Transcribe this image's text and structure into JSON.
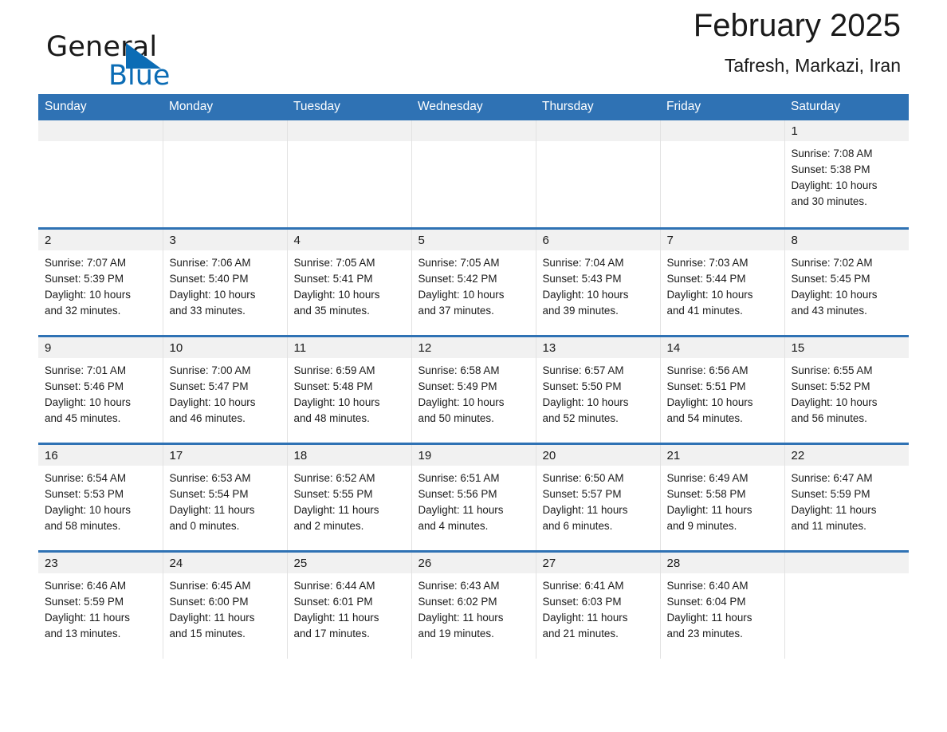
{
  "brand": {
    "name_part1": "General",
    "name_part2": "Blue",
    "flag_icon": "blue-triangle-flag-icon",
    "accent_color": "#0b6cb5"
  },
  "header": {
    "title": "February 2025",
    "subtitle": "Tafresh, Markazi, Iran"
  },
  "colors": {
    "header_row_bg": "#2f72b4",
    "daynum_band_bg": "#f1f1f1",
    "cell_border": "#2f72b4",
    "text": "#1a1a1a"
  },
  "calendar": {
    "weekday_headers": [
      "Sunday",
      "Monday",
      "Tuesday",
      "Wednesday",
      "Thursday",
      "Friday",
      "Saturday"
    ],
    "weeks": [
      [
        {
          "day": "",
          "empty": true
        },
        {
          "day": "",
          "empty": true
        },
        {
          "day": "",
          "empty": true
        },
        {
          "day": "",
          "empty": true
        },
        {
          "day": "",
          "empty": true
        },
        {
          "day": "",
          "empty": true
        },
        {
          "day": "1",
          "sunrise": "Sunrise: 7:08 AM",
          "sunset": "Sunset: 5:38 PM",
          "daylight_line1": "Daylight: 10 hours",
          "daylight_line2": "and 30 minutes."
        }
      ],
      [
        {
          "day": "2",
          "sunrise": "Sunrise: 7:07 AM",
          "sunset": "Sunset: 5:39 PM",
          "daylight_line1": "Daylight: 10 hours",
          "daylight_line2": "and 32 minutes."
        },
        {
          "day": "3",
          "sunrise": "Sunrise: 7:06 AM",
          "sunset": "Sunset: 5:40 PM",
          "daylight_line1": "Daylight: 10 hours",
          "daylight_line2": "and 33 minutes."
        },
        {
          "day": "4",
          "sunrise": "Sunrise: 7:05 AM",
          "sunset": "Sunset: 5:41 PM",
          "daylight_line1": "Daylight: 10 hours",
          "daylight_line2": "and 35 minutes."
        },
        {
          "day": "5",
          "sunrise": "Sunrise: 7:05 AM",
          "sunset": "Sunset: 5:42 PM",
          "daylight_line1": "Daylight: 10 hours",
          "daylight_line2": "and 37 minutes."
        },
        {
          "day": "6",
          "sunrise": "Sunrise: 7:04 AM",
          "sunset": "Sunset: 5:43 PM",
          "daylight_line1": "Daylight: 10 hours",
          "daylight_line2": "and 39 minutes."
        },
        {
          "day": "7",
          "sunrise": "Sunrise: 7:03 AM",
          "sunset": "Sunset: 5:44 PM",
          "daylight_line1": "Daylight: 10 hours",
          "daylight_line2": "and 41 minutes."
        },
        {
          "day": "8",
          "sunrise": "Sunrise: 7:02 AM",
          "sunset": "Sunset: 5:45 PM",
          "daylight_line1": "Daylight: 10 hours",
          "daylight_line2": "and 43 minutes."
        }
      ],
      [
        {
          "day": "9",
          "sunrise": "Sunrise: 7:01 AM",
          "sunset": "Sunset: 5:46 PM",
          "daylight_line1": "Daylight: 10 hours",
          "daylight_line2": "and 45 minutes."
        },
        {
          "day": "10",
          "sunrise": "Sunrise: 7:00 AM",
          "sunset": "Sunset: 5:47 PM",
          "daylight_line1": "Daylight: 10 hours",
          "daylight_line2": "and 46 minutes."
        },
        {
          "day": "11",
          "sunrise": "Sunrise: 6:59 AM",
          "sunset": "Sunset: 5:48 PM",
          "daylight_line1": "Daylight: 10 hours",
          "daylight_line2": "and 48 minutes."
        },
        {
          "day": "12",
          "sunrise": "Sunrise: 6:58 AM",
          "sunset": "Sunset: 5:49 PM",
          "daylight_line1": "Daylight: 10 hours",
          "daylight_line2": "and 50 minutes."
        },
        {
          "day": "13",
          "sunrise": "Sunrise: 6:57 AM",
          "sunset": "Sunset: 5:50 PM",
          "daylight_line1": "Daylight: 10 hours",
          "daylight_line2": "and 52 minutes."
        },
        {
          "day": "14",
          "sunrise": "Sunrise: 6:56 AM",
          "sunset": "Sunset: 5:51 PM",
          "daylight_line1": "Daylight: 10 hours",
          "daylight_line2": "and 54 minutes."
        },
        {
          "day": "15",
          "sunrise": "Sunrise: 6:55 AM",
          "sunset": "Sunset: 5:52 PM",
          "daylight_line1": "Daylight: 10 hours",
          "daylight_line2": "and 56 minutes."
        }
      ],
      [
        {
          "day": "16",
          "sunrise": "Sunrise: 6:54 AM",
          "sunset": "Sunset: 5:53 PM",
          "daylight_line1": "Daylight: 10 hours",
          "daylight_line2": "and 58 minutes."
        },
        {
          "day": "17",
          "sunrise": "Sunrise: 6:53 AM",
          "sunset": "Sunset: 5:54 PM",
          "daylight_line1": "Daylight: 11 hours",
          "daylight_line2": "and 0 minutes."
        },
        {
          "day": "18",
          "sunrise": "Sunrise: 6:52 AM",
          "sunset": "Sunset: 5:55 PM",
          "daylight_line1": "Daylight: 11 hours",
          "daylight_line2": "and 2 minutes."
        },
        {
          "day": "19",
          "sunrise": "Sunrise: 6:51 AM",
          "sunset": "Sunset: 5:56 PM",
          "daylight_line1": "Daylight: 11 hours",
          "daylight_line2": "and 4 minutes."
        },
        {
          "day": "20",
          "sunrise": "Sunrise: 6:50 AM",
          "sunset": "Sunset: 5:57 PM",
          "daylight_line1": "Daylight: 11 hours",
          "daylight_line2": "and 6 minutes."
        },
        {
          "day": "21",
          "sunrise": "Sunrise: 6:49 AM",
          "sunset": "Sunset: 5:58 PM",
          "daylight_line1": "Daylight: 11 hours",
          "daylight_line2": "and 9 minutes."
        },
        {
          "day": "22",
          "sunrise": "Sunrise: 6:47 AM",
          "sunset": "Sunset: 5:59 PM",
          "daylight_line1": "Daylight: 11 hours",
          "daylight_line2": "and 11 minutes."
        }
      ],
      [
        {
          "day": "23",
          "sunrise": "Sunrise: 6:46 AM",
          "sunset": "Sunset: 5:59 PM",
          "daylight_line1": "Daylight: 11 hours",
          "daylight_line2": "and 13 minutes."
        },
        {
          "day": "24",
          "sunrise": "Sunrise: 6:45 AM",
          "sunset": "Sunset: 6:00 PM",
          "daylight_line1": "Daylight: 11 hours",
          "daylight_line2": "and 15 minutes."
        },
        {
          "day": "25",
          "sunrise": "Sunrise: 6:44 AM",
          "sunset": "Sunset: 6:01 PM",
          "daylight_line1": "Daylight: 11 hours",
          "daylight_line2": "and 17 minutes."
        },
        {
          "day": "26",
          "sunrise": "Sunrise: 6:43 AM",
          "sunset": "Sunset: 6:02 PM",
          "daylight_line1": "Daylight: 11 hours",
          "daylight_line2": "and 19 minutes."
        },
        {
          "day": "27",
          "sunrise": "Sunrise: 6:41 AM",
          "sunset": "Sunset: 6:03 PM",
          "daylight_line1": "Daylight: 11 hours",
          "daylight_line2": "and 21 minutes."
        },
        {
          "day": "28",
          "sunrise": "Sunrise: 6:40 AM",
          "sunset": "Sunset: 6:04 PM",
          "daylight_line1": "Daylight: 11 hours",
          "daylight_line2": "and 23 minutes."
        },
        {
          "day": "",
          "empty": true
        }
      ]
    ]
  }
}
